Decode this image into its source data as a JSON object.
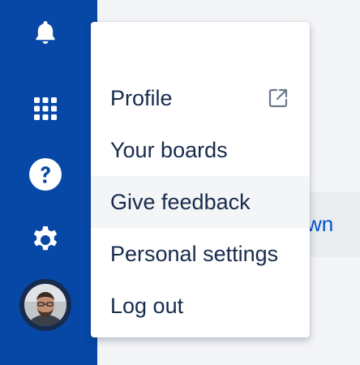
{
  "menu": {
    "items": [
      {
        "label": "Profile",
        "icon": "external-link-icon"
      },
      {
        "label": "Your boards"
      },
      {
        "label": "Give feedback",
        "hovered": true
      },
      {
        "label": "Personal settings"
      },
      {
        "label": "Log out"
      }
    ]
  },
  "background": {
    "row_text": "wn"
  },
  "rail": {
    "icons": [
      "notifications-icon",
      "app-switcher-icon",
      "help-icon",
      "settings-icon",
      "avatar"
    ]
  },
  "colors": {
    "rail_bg": "#0747a6",
    "text": "#172b4d",
    "hover_bg": "#f4f5f7",
    "link": "#0052cc"
  }
}
